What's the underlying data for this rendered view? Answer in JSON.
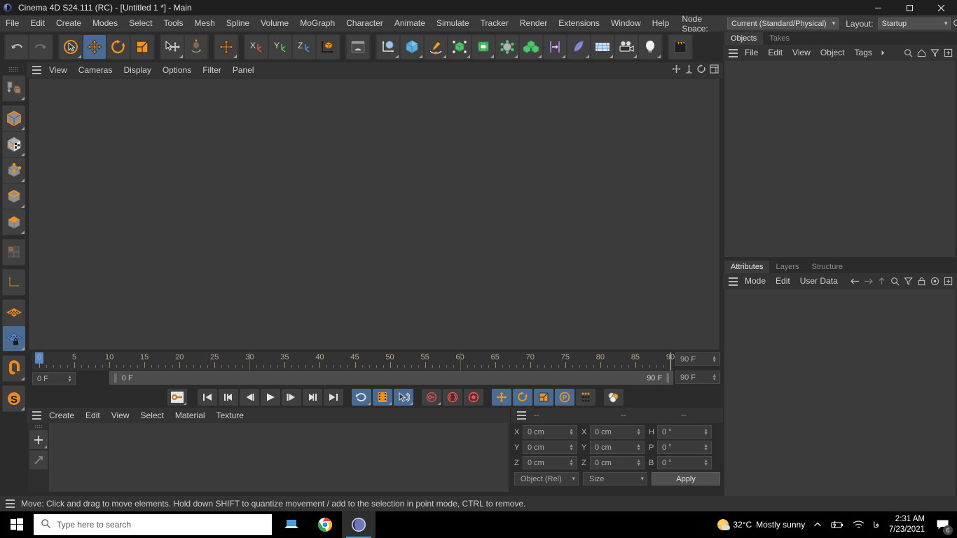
{
  "window": {
    "title": "Cinema 4D S24.111 (RC) - [Untitled 1 *] - Main",
    "app_icon": "cinema4d-logo-icon",
    "minimize_label": "─",
    "maximize_label": "☐",
    "close_label": "✕"
  },
  "menubar": {
    "items": [
      {
        "label": "File"
      },
      {
        "label": "Edit"
      },
      {
        "label": "Create"
      },
      {
        "label": "Modes"
      },
      {
        "label": "Select"
      },
      {
        "label": "Tools"
      },
      {
        "label": "Mesh"
      },
      {
        "label": "Spline"
      },
      {
        "label": "Volume"
      },
      {
        "label": "MoGraph"
      },
      {
        "label": "Character"
      },
      {
        "label": "Animate"
      },
      {
        "label": "Simulate"
      },
      {
        "label": "Tracker"
      },
      {
        "label": "Render"
      },
      {
        "label": "Extensions"
      },
      {
        "label": "Window"
      },
      {
        "label": "Help"
      }
    ],
    "node_space_label": "Node Space:",
    "node_space_value": "Current (Standard/Physical)",
    "layout_label": "Layout:",
    "layout_value": "Startup",
    "search_icon": "search-icon"
  },
  "toolbar": {
    "groups": [
      {
        "name": "history",
        "buttons": [
          {
            "name": "undo-button",
            "icon": "undo-icon"
          },
          {
            "name": "redo-button",
            "icon": "redo-icon"
          }
        ]
      },
      {
        "name": "transform-tools",
        "buttons": [
          {
            "name": "live-selection-tool",
            "icon": "live-selection-icon"
          },
          {
            "name": "move-tool",
            "icon": "move-icon",
            "active": true
          },
          {
            "name": "rotate-tool",
            "icon": "rotate-icon"
          },
          {
            "name": "scale-tool",
            "icon": "scale-icon"
          }
        ]
      },
      {
        "name": "world-object-axis",
        "buttons": [
          {
            "name": "select-move-tool",
            "icon": "select-move-icon"
          },
          {
            "name": "enable-axis-modification",
            "icon": "axis-modification-icon"
          }
        ]
      },
      {
        "name": "coordinate-system",
        "buttons": [
          {
            "name": "world-coordinate-system",
            "icon": "move-icon"
          }
        ]
      },
      {
        "name": "axis-locks",
        "buttons": [
          {
            "name": "lock-x-axis",
            "icon": "x-axis-icon"
          },
          {
            "name": "lock-y-axis",
            "icon": "y-axis-icon"
          },
          {
            "name": "lock-z-axis",
            "icon": "z-axis-icon"
          },
          {
            "name": "world-object-toggle",
            "icon": "world-object-icon"
          }
        ]
      },
      {
        "name": "render-group",
        "buttons": [
          {
            "name": "render-view-button",
            "icon": "render-view-icon"
          }
        ]
      },
      {
        "name": "object-creation",
        "buttons": [
          {
            "name": "add-null-object",
            "icon": "null-object-icon"
          },
          {
            "name": "add-cube-object",
            "icon": "cube-icon"
          },
          {
            "name": "add-spline-pen",
            "icon": "pen-spline-icon"
          },
          {
            "name": "add-generator-object",
            "icon": "generator-icon"
          },
          {
            "name": "add-subdivision-surface",
            "icon": "subdivision-icon"
          },
          {
            "name": "add-deformer-object",
            "icon": "deformer-icon"
          },
          {
            "name": "add-mograph-object",
            "icon": "mograph-cloner-icon"
          },
          {
            "name": "add-field-object",
            "icon": "field-icon"
          },
          {
            "name": "add-scene-object",
            "icon": "scene-object-icon"
          },
          {
            "name": "add-floor-object",
            "icon": "floor-icon"
          },
          {
            "name": "add-camera-object",
            "icon": "camera-icon"
          },
          {
            "name": "add-light-object",
            "icon": "light-bulb-icon"
          }
        ]
      },
      {
        "name": "content-browser-group",
        "buttons": [
          {
            "name": "content-browser-button",
            "icon": "content-browser-icon"
          }
        ]
      }
    ]
  },
  "left_palette": {
    "groups": [
      {
        "buttons": [
          {
            "name": "make-editable-tool",
            "icon": "make-editable-icon"
          }
        ]
      },
      {
        "buttons": [
          {
            "name": "model-mode",
            "icon": "model-mode-icon"
          },
          {
            "name": "texture-mode",
            "icon": "texture-mode-icon"
          },
          {
            "name": "points-mode",
            "icon": "points-mode-icon"
          },
          {
            "name": "edges-mode",
            "icon": "edges-mode-icon"
          },
          {
            "name": "polygons-mode",
            "icon": "polygons-mode-icon"
          }
        ]
      },
      {
        "buttons": [
          {
            "name": "uv-mode",
            "icon": "uv-mode-icon"
          }
        ]
      },
      {
        "buttons": [
          {
            "name": "axis-mode",
            "icon": "axis-mode-icon"
          }
        ]
      },
      {
        "buttons": [
          {
            "name": "enable-snapping",
            "icon": "snap-grid-icon"
          },
          {
            "name": "lock-workplane",
            "icon": "workplane-lock-icon",
            "active": true
          }
        ]
      },
      {
        "buttons": [
          {
            "name": "magnet-tool",
            "icon": "magnet-icon"
          }
        ]
      },
      {
        "buttons": [
          {
            "name": "smooth-tool",
            "icon": "smooth-s-icon"
          }
        ]
      }
    ]
  },
  "viewport": {
    "menu_items": [
      {
        "label": "View"
      },
      {
        "label": "Cameras"
      },
      {
        "label": "Display"
      },
      {
        "label": "Options"
      },
      {
        "label": "Filter"
      },
      {
        "label": "Panel"
      }
    ],
    "nav_icons": [
      {
        "name": "pan-view-icon"
      },
      {
        "name": "zoom-view-icon"
      },
      {
        "name": "rotate-view-icon"
      },
      {
        "name": "maximize-view-icon"
      }
    ],
    "background_color": "#3b3b3b"
  },
  "timeline": {
    "tick_labels": [
      "0",
      "5",
      "10",
      "15",
      "20",
      "25",
      "30",
      "35",
      "40",
      "45",
      "50",
      "55",
      "60",
      "65",
      "70",
      "75",
      "80",
      "85",
      "90"
    ],
    "tick_values": [
      0,
      5,
      10,
      15,
      20,
      25,
      30,
      35,
      40,
      45,
      50,
      55,
      60,
      65,
      70,
      75,
      80,
      85,
      90
    ],
    "range_start": 0,
    "range_end": 90,
    "playhead_frame": 0,
    "current_frame_field": "0 F",
    "preview_start_field": "0 F",
    "preview_end_field": "90 F",
    "max_frame_field": "90 F",
    "end_frame_field": "90 F",
    "label_color": "#b7a78e"
  },
  "transport": {
    "buttons": [
      {
        "name": "record-active-objects-button",
        "icon": "record-key-icon"
      },
      {
        "name": "go-to-start-button",
        "icon": "skip-start-icon"
      },
      {
        "name": "go-to-previous-key-button",
        "icon": "prev-key-icon"
      },
      {
        "name": "go-to-previous-frame-button",
        "icon": "step-back-icon"
      },
      {
        "name": "play-button",
        "icon": "play-icon"
      },
      {
        "name": "go-to-next-frame-button",
        "icon": "step-forward-icon"
      },
      {
        "name": "go-to-next-key-button",
        "icon": "next-key-icon"
      },
      {
        "name": "go-to-end-button",
        "icon": "skip-end-icon"
      },
      {
        "name": "loop-playback-button",
        "icon": "loop-icon",
        "on": true
      },
      {
        "name": "record-button",
        "icon": "film-strip-icon",
        "on": true
      },
      {
        "name": "autokeying-button",
        "icon": "autokey-icon",
        "on": true
      },
      {
        "name": "keyframe-selection-button",
        "icon": "key-disabled-icon"
      },
      {
        "name": "position-key-button",
        "icon": "position-key-icon"
      },
      {
        "name": "rotation-key-button",
        "icon": "rotation-key-icon"
      },
      {
        "name": "scale-key-button",
        "icon": "scale-key-icon"
      },
      {
        "name": "position-track-button",
        "icon": "move-icon",
        "on": true
      },
      {
        "name": "rotation-track-button",
        "icon": "rotate-icon",
        "on": true
      },
      {
        "name": "scale-track-button",
        "icon": "scale-icon",
        "on": true
      },
      {
        "name": "param-track-button",
        "icon": "pla-icon",
        "on": true
      },
      {
        "name": "point-level-animation-button",
        "icon": "dot-grid-icon"
      },
      {
        "name": "project-settings-button",
        "icon": "project-spheres-icon"
      }
    ]
  },
  "material_manager": {
    "menu_items": [
      {
        "label": "Create"
      },
      {
        "label": "Edit"
      },
      {
        "label": "View"
      },
      {
        "label": "Select"
      },
      {
        "label": "Material"
      },
      {
        "label": "Texture"
      }
    ],
    "side_buttons": [
      {
        "name": "new-material-button",
        "icon": "plus-icon"
      },
      {
        "name": "apply-material-button",
        "icon": "diagonal-arrow-icon"
      }
    ]
  },
  "coordinates": {
    "header_cells": [
      "--",
      "--",
      "--"
    ],
    "rows": [
      {
        "pos_label": "X",
        "pos_value": "0 cm",
        "size_label": "X",
        "size_value": "0 cm",
        "rot_label": "H",
        "rot_value": "0 °"
      },
      {
        "pos_label": "Y",
        "pos_value": "0 cm",
        "size_label": "Y",
        "size_value": "0 cm",
        "rot_label": "P",
        "rot_value": "0 °"
      },
      {
        "pos_label": "Z",
        "pos_value": "0 cm",
        "size_label": "Z",
        "size_value": "0 cm",
        "rot_label": "B",
        "rot_value": "0 °"
      }
    ],
    "mode_select": "Object (Rel)",
    "size_select": "Size",
    "apply_label": "Apply"
  },
  "objects_panel": {
    "tabs": [
      {
        "label": "Objects",
        "active": true
      },
      {
        "label": "Takes",
        "active": false
      }
    ],
    "menu_items": [
      {
        "label": "File"
      },
      {
        "label": "Edit"
      },
      {
        "label": "View"
      },
      {
        "label": "Object"
      },
      {
        "label": "Tags"
      }
    ],
    "overflow_icon": "chevron-right-icon",
    "tool_icons": [
      {
        "name": "search-icon"
      },
      {
        "name": "home-icon"
      },
      {
        "name": "filter-icon"
      },
      {
        "name": "add-panel-icon"
      }
    ]
  },
  "attributes_panel": {
    "tabs": [
      {
        "label": "Attributes",
        "active": true
      },
      {
        "label": "Layers",
        "active": false
      },
      {
        "label": "Structure",
        "active": false
      }
    ],
    "menu_items": [
      {
        "label": "Mode"
      },
      {
        "label": "Edit"
      },
      {
        "label": "User Data"
      }
    ],
    "tool_icons": [
      {
        "name": "back-arrow-icon"
      },
      {
        "name": "forward-arrow-icon"
      },
      {
        "name": "up-arrow-icon"
      },
      {
        "name": "search-icon"
      },
      {
        "name": "filter-icon"
      },
      {
        "name": "lock-icon"
      },
      {
        "name": "target-icon"
      },
      {
        "name": "add-panel-icon"
      }
    ]
  },
  "statusbar": {
    "hamburger_icon": "menu-icon",
    "text": "Move: Click and drag to move elements. Hold down SHIFT to quantize movement / add to the selection in point mode, CTRL to remove."
  },
  "taskbar": {
    "start_icon": "windows-start-icon",
    "search_icon": "search-icon",
    "search_placeholder": "Type here to search",
    "apps": [
      {
        "name": "task-view-button",
        "icon": "task-view-icon"
      },
      {
        "name": "chrome-taskbar-button",
        "icon": "chrome-icon"
      },
      {
        "name": "cinema4d-taskbar-button",
        "icon": "cinema4d-logo-icon",
        "active": true
      }
    ],
    "weather_icon": "sun-cloud-icon",
    "weather_temp": "32°C",
    "weather_desc": "Mostly sunny",
    "tray_icons": [
      {
        "name": "show-hidden-icons-chevron"
      },
      {
        "name": "battery-icon"
      },
      {
        "name": "wifi-icon"
      },
      {
        "name": "language-icon",
        "label": "فا"
      }
    ],
    "time": "2:31 AM",
    "date": "7/23/2021",
    "notification_icon": "notification-icon",
    "notification_count": "6"
  },
  "colors": {
    "accent_orange": "#e98a23",
    "active_blue": "#4a6b94",
    "panel_bg": "#2b2b2b",
    "viewport_bg": "#3b3b3b",
    "menubar_bg": "#3a3a3a"
  }
}
